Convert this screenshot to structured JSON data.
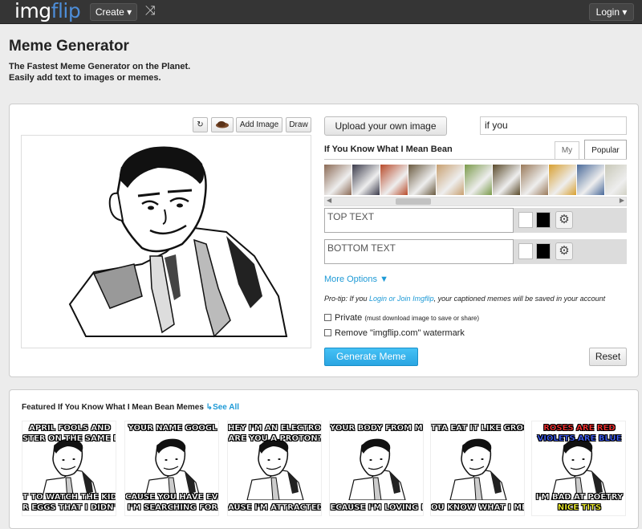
{
  "header": {
    "logo_img": "img",
    "logo_flip": "flip",
    "create_label": "Create ▾",
    "shuffle_icon": "⤨",
    "login_label": "Login ▾"
  },
  "page": {
    "title": "Meme Generator",
    "tagline_1": "The Fastest Meme Generator on the Planet.",
    "tagline_2": "Easily add text to images or memes."
  },
  "tools": {
    "rotate_icon": "↻",
    "add_image": "Add Image",
    "draw": "Draw"
  },
  "generator": {
    "upload_label": "Upload your own image",
    "search_value": "if you",
    "template_name": "If You Know What I Mean Bean",
    "tab_my": "My",
    "tab_popular": "Popular",
    "top_text_placeholder": "TOP TEXT",
    "bottom_text_placeholder": "BOTTOM TEXT",
    "gear_icon": "⚙",
    "more_options": "More Options ▼",
    "protip_prefix": "Pro-tip: If you ",
    "protip_link": "Login or Join Imgflip",
    "protip_suffix": ", your captioned memes will be saved in your account",
    "private_label": "Private",
    "private_note": "(must download image to save or share)",
    "watermark_label": "Remove \"imgflip.com\" watermark",
    "generate_label": "Generate Meme",
    "reset_label": "Reset"
  },
  "thumb_colors": [
    "#8b6a55",
    "#3a3a4a",
    "#b84a2a",
    "#6a5a40",
    "#c8a070",
    "#7a9a4a",
    "#5a4a2a",
    "#9a7a5a",
    "#d8a030",
    "#4a6a9a",
    "#c8c8b8"
  ],
  "featured": {
    "title_prefix": "Featured If You Know What I Mean Bean Memes",
    "see_all": "See All",
    "memes": [
      {
        "top": "APRIL FOOLS AND",
        "top2": "STER ON THE SAME D",
        "bottom": "T TO WATCH THE KIDS LO",
        "bottom2": "R EGGS THAT I DIDN'T HI"
      },
      {
        "top": "YOUR NAME GOOGL",
        "top2": "",
        "bottom": "CAUSE YOU HAVE EVERYTH",
        "bottom2": "I'M SEARCHING FOR"
      },
      {
        "top": "HEY I'M AN ELECTRON",
        "top2": "ARE YOU A PROTON?",
        "bottom": "AUSE I'M ATTRACTED TO Y",
        "bottom2": ""
      },
      {
        "top": "YOUR BODY FROM MCDONALD",
        "top2": "",
        "bottom": "ECAUSE I'M LOVING I",
        "bottom2": ""
      },
      {
        "top": "TTA EAT IT LIKE GROCER",
        "top2": "",
        "bottom": "OU KNOW WHAT I ME",
        "bottom2": ""
      },
      {
        "top": "ROSES ARE RED",
        "top2": "VIOLETS ARE BLUE",
        "bottom": "I'M BAD AT POETRY",
        "bottom2": "NICE TITS"
      }
    ]
  }
}
